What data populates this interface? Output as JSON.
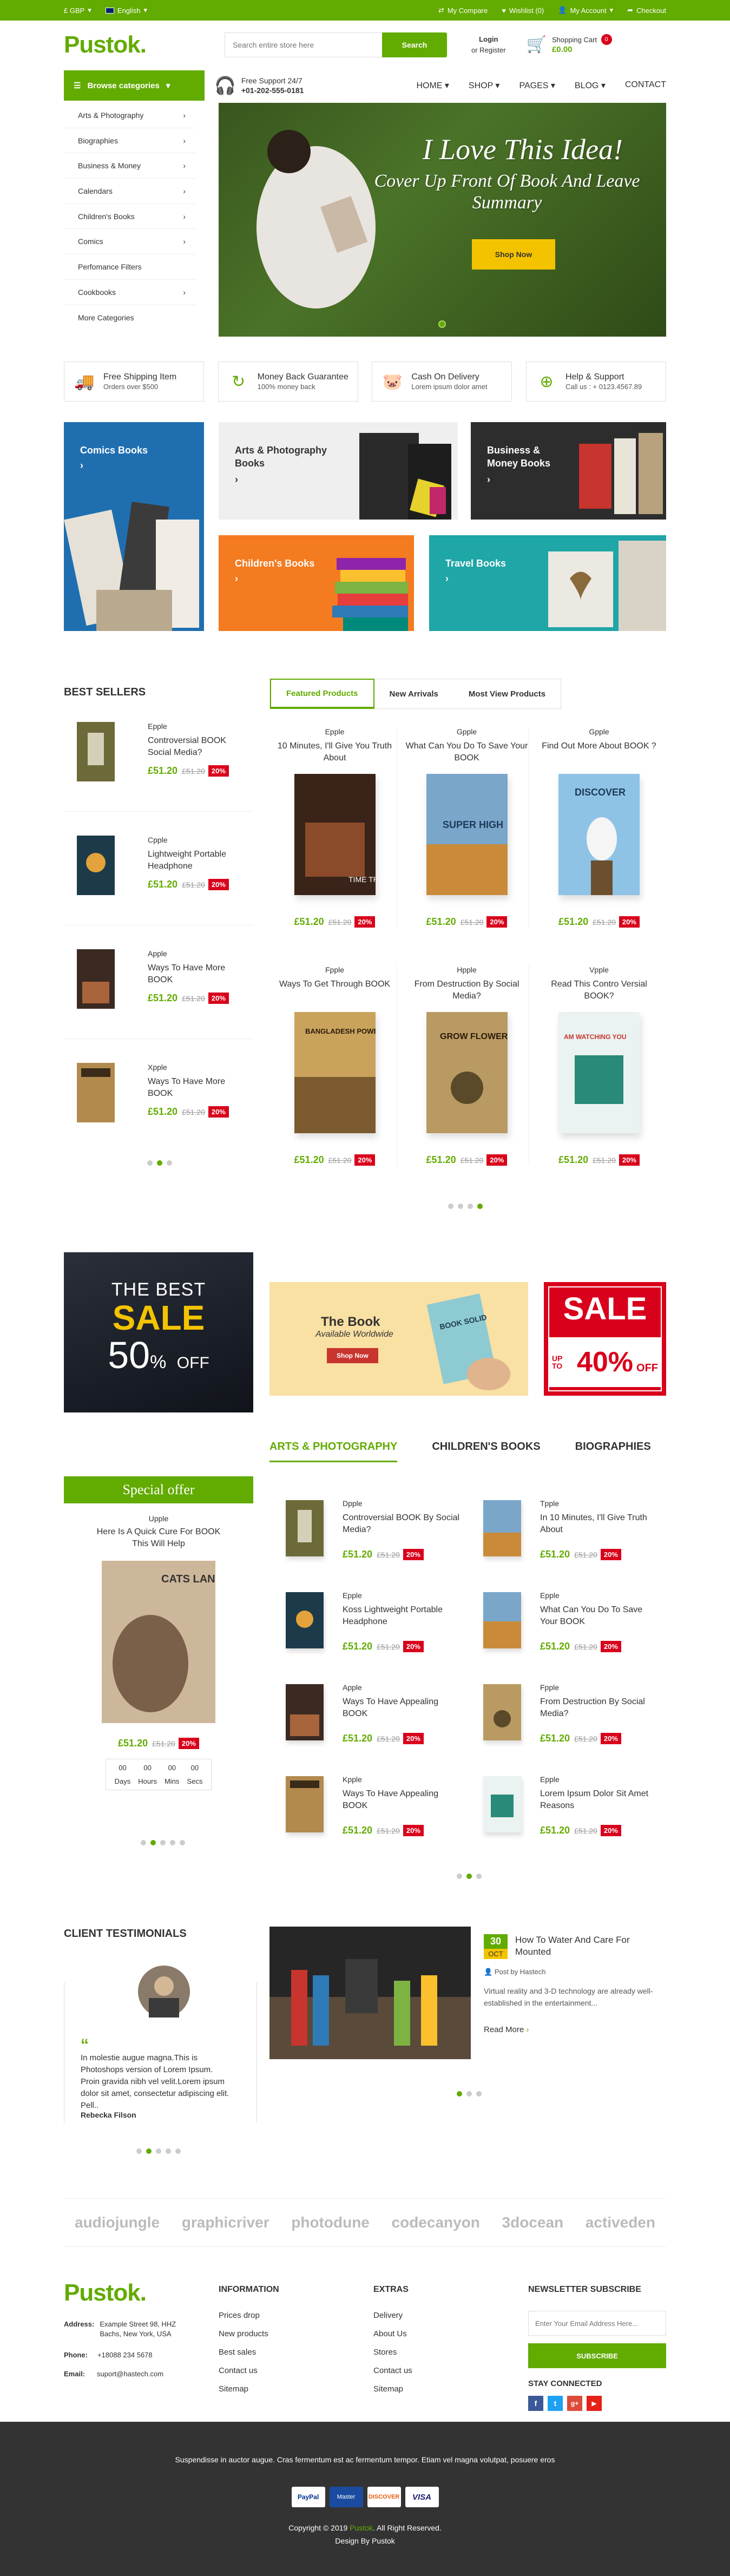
{
  "topbar": {
    "currency": "£ GBP",
    "language": "English",
    "compare": "My Compare",
    "wishlist": "Wishlist (0)",
    "account": "My Account",
    "checkout": "Checkout"
  },
  "header": {
    "logo": "Pustok.",
    "search_placeholder": "Search entire store here",
    "search_button": "Search",
    "login": "Login",
    "register": "or Register",
    "cart_label": "Shopping Cart",
    "cart_amount": "£0.00",
    "cart_count": "0"
  },
  "nav": {
    "browse": "Browse categories",
    "support_title": "Free Support 24/7",
    "support_phone": "+01-202-555-0181",
    "menu": [
      "HOME",
      "SHOP",
      "PAGES",
      "BLOG",
      "CONTACT"
    ]
  },
  "categories": [
    "Arts & Photography",
    "Biographies",
    "Business & Money",
    "Calendars",
    "Children's Books",
    "Comics",
    "Perfomance Filters",
    "Cookbooks",
    "More Categories"
  ],
  "hero": {
    "title": "I Love This Idea!",
    "subtitle": "Cover Up Front Of Book And Leave Summary",
    "button": "Shop Now"
  },
  "features": [
    {
      "title": "Free Shipping Item",
      "text": "Orders over $500"
    },
    {
      "title": "Money Back Guarantee",
      "text": "100% money back"
    },
    {
      "title": "Cash On Delivery",
      "text": "Lorem ipsum dolor amet"
    },
    {
      "title": "Help & Support",
      "text": "Call us : + 0123.4567.89"
    }
  ],
  "tiles": {
    "comics": "Comics Books",
    "arts": "Arts & Photography Books",
    "business": "Business & Money Books",
    "children": "Children's Books",
    "travel": "Travel Books"
  },
  "bestsellers": {
    "title": "BEST SELLERS",
    "items": [
      {
        "brand": "Epple",
        "name": "Controversial BOOK Social Media?",
        "price": "£51.20",
        "old": "£51.20",
        "off": "20%"
      },
      {
        "brand": "Cpple",
        "name": "Lightweight Portable Headphone",
        "price": "£51.20",
        "old": "£51.20",
        "off": "20%"
      },
      {
        "brand": "Apple",
        "name": "Ways To Have More BOOK",
        "price": "£51.20",
        "old": "£51.20",
        "off": "20%"
      },
      {
        "brand": "Xpple",
        "name": "Ways To Have More BOOK",
        "price": "£51.20",
        "old": "£51.20",
        "off": "20%"
      }
    ]
  },
  "product_tabs": [
    "Featured Products",
    "New Arrivals",
    "Most View Products"
  ],
  "products": [
    {
      "brand": "Epple",
      "name": "10 Minutes, I'll Give You Truth About",
      "price": "£51.20",
      "old": "£51.20",
      "off": "20%",
      "cover": "TIME TRAVEL"
    },
    {
      "brand": "Gpple",
      "name": "What Can You Do To Save Your BOOK",
      "price": "£51.20",
      "old": "£51.20",
      "off": "20%",
      "cover": "SUPER HIGH"
    },
    {
      "brand": "Gpple",
      "name": "Find Out More About BOOK ?",
      "price": "£51.20",
      "old": "£51.20",
      "off": "20%",
      "cover": "DISCOVER"
    },
    {
      "brand": "Fpple",
      "name": "Ways To Get Through BOOK",
      "price": "£51.20",
      "old": "£51.20",
      "off": "20%",
      "cover": "BANGLADESH POWER"
    },
    {
      "brand": "Hpple",
      "name": "From Destruction By Social Media?",
      "price": "£51.20",
      "old": "£51.20",
      "off": "20%",
      "cover": "GROW FLOWER"
    },
    {
      "brand": "Vpple",
      "name": "Read This Contro Versial BOOK?",
      "price": "£51.20",
      "old": "£51.20",
      "off": "20%",
      "cover": "AM WATCHING YOU"
    }
  ],
  "promos": {
    "best": "THE BEST",
    "sale": "SALE",
    "pct": "50",
    "off": "OFF",
    "book_title": "The Book",
    "book_sub": "Available Worldwide",
    "book_btn": "Shop Now",
    "book_cover": "BOOK SOLID",
    "sale2": "SALE",
    "upto": "UP TO",
    "pct2": "40%",
    "off2": "OFF"
  },
  "special": {
    "title": "Special offer",
    "brand": "Upple",
    "name": "Here Is A Quick Cure For BOOK This Will Help",
    "cover": "CATS LANGUAGE",
    "price": "£51.20",
    "old": "£51.20",
    "off": "20%",
    "countdown": [
      {
        "v": "00",
        "l": "Days"
      },
      {
        "v": "00",
        "l": "Hours"
      },
      {
        "v": "00",
        "l": "Mins"
      },
      {
        "v": "00",
        "l": "Secs"
      }
    ]
  },
  "tabs2": [
    "ARTS & PHOTOGRAPHY",
    "CHILDREN'S BOOKS",
    "BIOGRAPHIES"
  ],
  "list2": [
    {
      "brand": "Dpple",
      "name": "Controversial BOOK By Social Media?",
      "price": "£51.20",
      "old": "£51.20",
      "off": "20%"
    },
    {
      "brand": "Tpple",
      "name": "In 10 Minutes, I'll Give Truth About",
      "price": "£51.20",
      "old": "£51.20",
      "off": "20%"
    },
    {
      "brand": "Epple",
      "name": "Koss Lightweight Portable Headphone",
      "price": "£51.20",
      "old": "£51.20",
      "off": "20%"
    },
    {
      "brand": "Epple",
      "name": "What Can You Do To Save Your BOOK",
      "price": "£51.20",
      "old": "£51.20",
      "off": "20%"
    },
    {
      "brand": "Apple",
      "name": "Ways To Have Appealing BOOK",
      "price": "£51.20",
      "old": "£51.20",
      "off": "20%"
    },
    {
      "brand": "Fpple",
      "name": "From Destruction By Social Media?",
      "price": "£51.20",
      "old": "£51.20",
      "off": "20%"
    },
    {
      "brand": "Kpple",
      "name": "Ways To Have Appealing BOOK",
      "price": "£51.20",
      "old": "£51.20",
      "off": "20%"
    },
    {
      "brand": "Epple",
      "name": "Lorem Ipsum Dolor Sit Amet Reasons",
      "price": "£51.20",
      "old": "£51.20",
      "off": "20%"
    }
  ],
  "testimonials": {
    "title": "CLIENT TESTIMONIALS",
    "quote": "In molestie augue magna.This is Photoshops version of Lorem Ipsum. Proin gravida nibh vel velit.Lorem ipsum dolor sit amet, consectetur adipiscing elit. Pell..",
    "author": "Rebecka Filson"
  },
  "blog": {
    "day": "30",
    "month": "Oct",
    "title": "How To Water And Care For Mounted",
    "author": "Post by Hastech",
    "text": "Virtual reality and 3-D technology are already well-established in the entertainment...",
    "more": "Read More"
  },
  "brands": [
    "audiojungle",
    "graphicriver",
    "photodune",
    "codecanyon",
    "3docean",
    "activeden"
  ],
  "footer": {
    "logo": "Pustok.",
    "address_label": "Address:",
    "address": "Example Street 98, HHZ Bachs, New York, USA",
    "phone_label": "Phone:",
    "phone": "+18088 234 5678",
    "email_label": "Email:",
    "email": "suport@hastech.com",
    "info_title": "INFORMATION",
    "info": [
      "Prices drop",
      "New products",
      "Best sales",
      "Contact us",
      "Sitemap"
    ],
    "extras_title": "EXTRAS",
    "extras": [
      "Delivery",
      "About Us",
      "Stores",
      "Contact us",
      "Sitemap"
    ],
    "news_title": "NEWSLETTER SUBSCRIBE",
    "news_placeholder": "Enter Your Email Address Here...",
    "subscribe": "SUBSCRIBE",
    "connect": "STAY CONNECTED"
  },
  "bottom": {
    "text": "Suspendisse in auctor augue. Cras fermentum est ac fermentum tempor. Etiam vel magna volutpat, posuere eros",
    "cards": [
      "PayPal",
      "Master",
      "DISCOVER",
      "VISA"
    ],
    "copyright_pre": "Copyright © 2019 ",
    "copyright_brand": "Pustok",
    "copyright_post": ". All Right Reserved.",
    "design": "Design By Pustok"
  },
  "colors": {
    "accent": "#62ab00",
    "sale": "#d9001b",
    "dark": "#333333"
  }
}
